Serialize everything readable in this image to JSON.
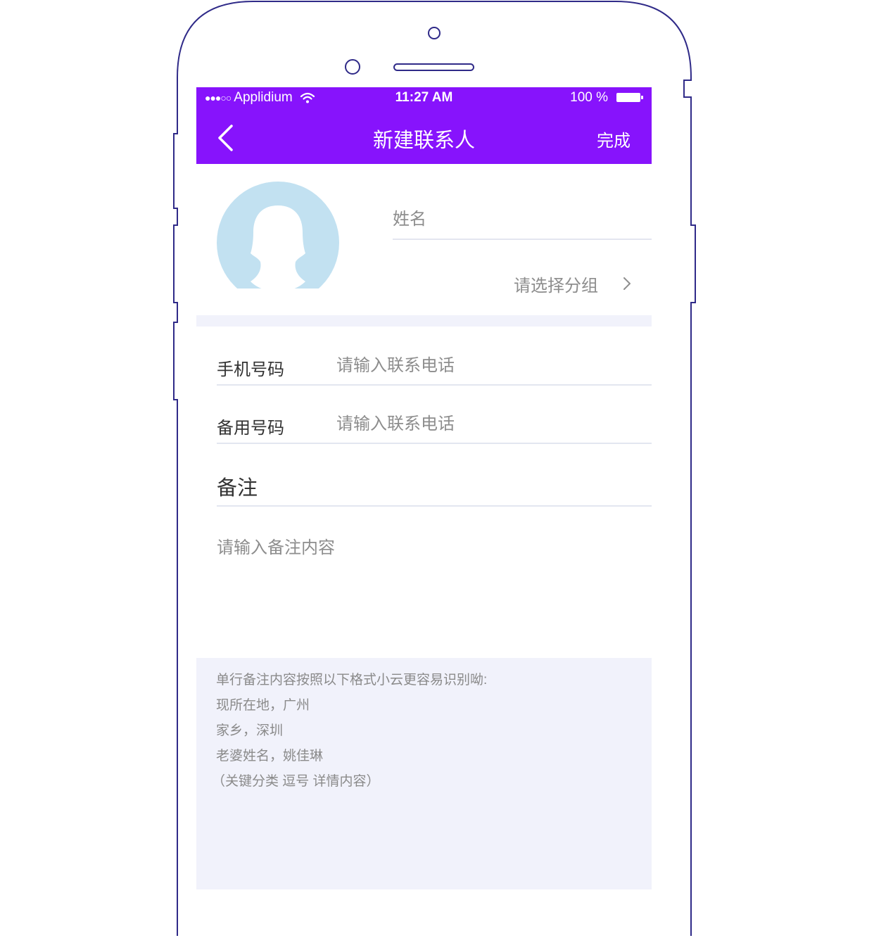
{
  "status_bar": {
    "signal": "●●●○○",
    "carrier": "Applidium",
    "time": "11:27 AM",
    "battery": "100 %"
  },
  "nav": {
    "title": "新建联系人",
    "done_label": "完成"
  },
  "form": {
    "name_placeholder": "姓名",
    "group_label": "请选择分组",
    "mobile": {
      "label": "手机号码",
      "placeholder": "请输入联系电话"
    },
    "backup": {
      "label": "备用号码",
      "placeholder": "请输入联系电话"
    },
    "notes": {
      "label": "备注",
      "placeholder": "请输入备注内容"
    }
  },
  "hint": {
    "lines": [
      "单行备注内容按照以下格式小云更容易识别呦:",
      "现所在地，广州",
      "家乡，深圳",
      "老婆姓名，姚佳琳",
      "（关键分类 逗号 详情内容）"
    ]
  },
  "colors": {
    "accent": "#8713fc",
    "avatar": "#c2e1f1",
    "separator": "#f1f2fb",
    "phone_outline": "#2f2a88"
  }
}
